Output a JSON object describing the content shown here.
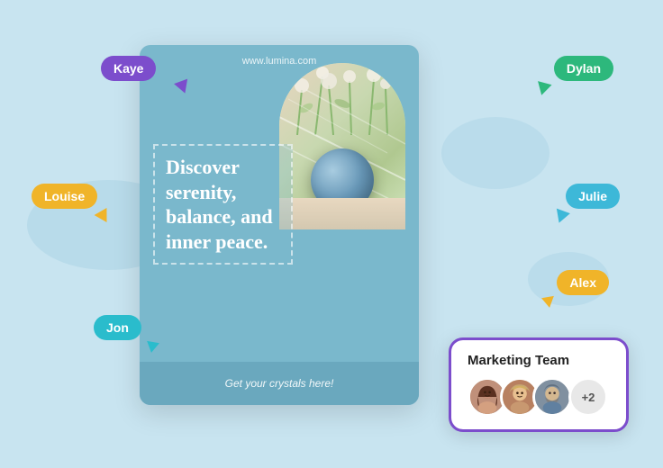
{
  "background_color": "#c8e4f0",
  "card": {
    "url": "www.lumina.com",
    "headline": "Discover serenity, balance, and inner peace.",
    "cta": "Get your crystals here!"
  },
  "badges": [
    {
      "name": "Kaye",
      "color": "#7c4dcc"
    },
    {
      "name": "Dylan",
      "color": "#2db87c"
    },
    {
      "name": "Louise",
      "color": "#f0b429"
    },
    {
      "name": "Julie",
      "color": "#3db8d8"
    },
    {
      "name": "Jon",
      "color": "#2abccc"
    },
    {
      "name": "Alex",
      "color": "#f0b429"
    }
  ],
  "marketing_team": {
    "title": "Marketing Team",
    "extra_count": "+2",
    "avatars": [
      {
        "id": "avatar-1",
        "color": "#b8705a"
      },
      {
        "id": "avatar-2",
        "color": "#c89060"
      },
      {
        "id": "avatar-3",
        "color": "#7090a0"
      }
    ]
  }
}
